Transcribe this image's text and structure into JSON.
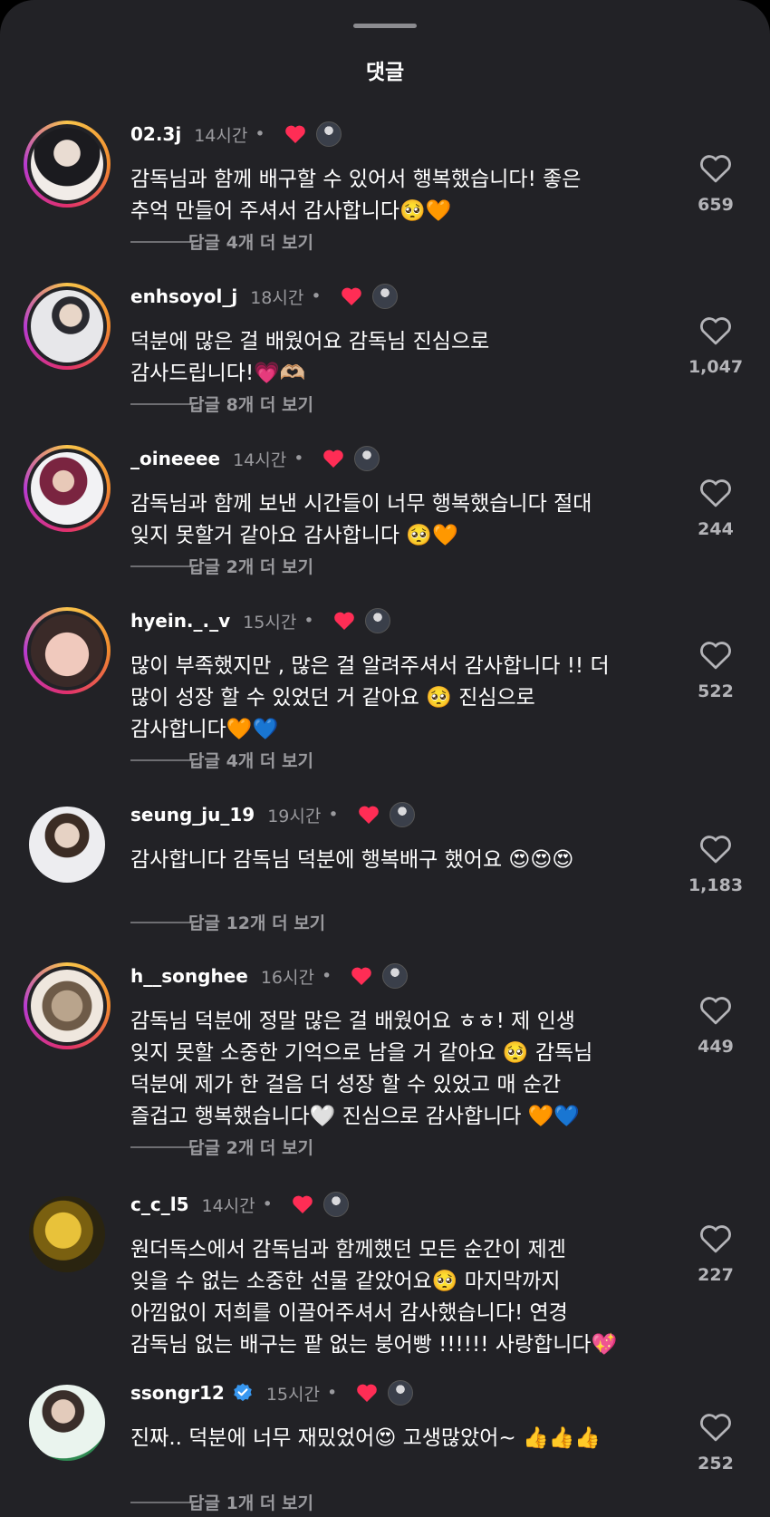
{
  "header": {
    "title": "댓글"
  },
  "comments": [
    {
      "username": "02.3j",
      "time": "14시간",
      "text": "감독님과 함께 배구할 수 있어서 행복했습니다! 좋은\n추억 만들어 주셔서 감사합니다🥺🧡",
      "replies": "답글 4개 더 보기",
      "likes": "659"
    },
    {
      "username": "enhsoyol_j",
      "time": "18시간",
      "text": "덕분에 많은 걸 배웠어요 감독님 진심으로\n감사드립니다!💗🫶🏼",
      "replies": "답글 8개 더 보기",
      "likes": "1,047"
    },
    {
      "username": "_oineeee",
      "time": "14시간",
      "text": "감독님과 함께 보낸 시간들이 너무 행복했습니다 절대\n잊지 못할거 같아요 감사합니다 🥺🧡",
      "replies": "답글 2개 더 보기",
      "likes": "244"
    },
    {
      "username": "hyein._._v",
      "time": "15시간",
      "text": "많이 부족했지만 , 많은 걸 알려주셔서 감사합니다 !! 더\n많이 성장 할 수 있었던 거 같아요 🥺 진심으로\n감사합니다🧡💙",
      "replies": "답글 4개 더 보기",
      "likes": "522"
    },
    {
      "username": "seung_ju_19",
      "time": "19시간",
      "text": "감사합니다 감독님 덕분에 행복배구 했어요 😍😍😍",
      "replies": "답글 12개 더 보기",
      "likes": "1,183"
    },
    {
      "username": "h__songhee",
      "time": "16시간",
      "text": "감독님 덕분에 정말 많은 걸 배웠어요 ㅎㅎ! 제 인생\n잊지 못할 소중한 기억으로 남을 거 같아요 🥺 감독님\n덕분에 제가 한 걸음 더 성장 할 수 있었고 매 순간\n즐겁고 행복했습니다🤍 진심으로 감사합니다 🧡💙",
      "replies": "답글 2개 더 보기",
      "likes": "449"
    },
    {
      "username": "c_c_l5",
      "time": "14시간",
      "text": "원더독스에서 감독님과 함께했던 모든 순간이 제겐\n잊을 수 없는 소중한 선물 같았어요🥺 마지막까지\n아낌없이 저희를 이끌어주셔서 감사했습니다! 연경\n감독님 없는 배구는 팥 없는 붕어빵 !!!!!! 사랑합니다💖",
      "replies": "",
      "likes": "227"
    },
    {
      "username": "ssongr12",
      "time": "15시간",
      "text": "진짜.. 덕분에 너무 재밌었어😍 고생많았어~ 👍👍👍",
      "replies": "답글 1개 더 보기",
      "likes": "252"
    }
  ],
  "colors": {
    "background": "#222226",
    "secondary_text": "#9a9a9e",
    "like_heart": "#ff2d55"
  }
}
